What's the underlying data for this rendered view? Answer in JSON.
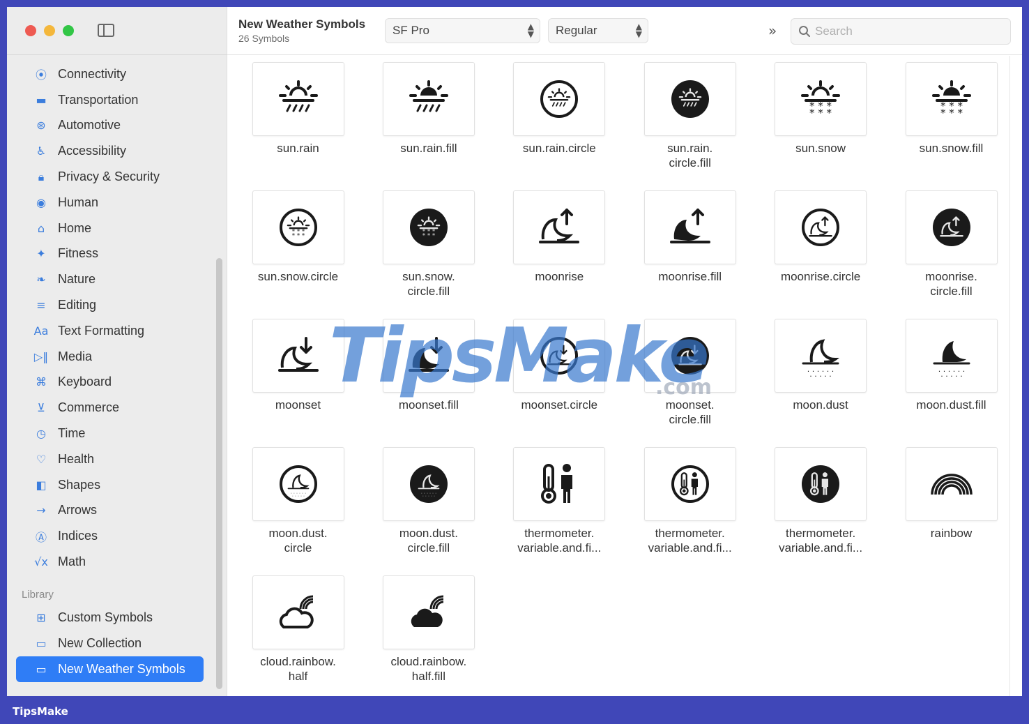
{
  "toolbar": {
    "collection_title": "New Weather Symbols",
    "symbol_count": "26 Symbols",
    "font_popup": "SF Pro",
    "weight_popup": "Regular",
    "search_placeholder": "Search"
  },
  "sidebar": {
    "categories": [
      {
        "label": "Connectivity",
        "icon": "antenna-icon"
      },
      {
        "label": "Transportation",
        "icon": "car-icon"
      },
      {
        "label": "Automotive",
        "icon": "steering-wheel-icon"
      },
      {
        "label": "Accessibility",
        "icon": "accessibility-icon"
      },
      {
        "label": "Privacy & Security",
        "icon": "lock-icon"
      },
      {
        "label": "Human",
        "icon": "person-circle-icon"
      },
      {
        "label": "Home",
        "icon": "house-icon"
      },
      {
        "label": "Fitness",
        "icon": "running-figure-icon"
      },
      {
        "label": "Nature",
        "icon": "leaf-icon"
      },
      {
        "label": "Editing",
        "icon": "sliders-icon"
      },
      {
        "label": "Text Formatting",
        "icon": "text-aa-icon"
      },
      {
        "label": "Media",
        "icon": "play-pause-icon"
      },
      {
        "label": "Keyboard",
        "icon": "command-key-icon"
      },
      {
        "label": "Commerce",
        "icon": "cart-icon"
      },
      {
        "label": "Time",
        "icon": "clock-icon"
      },
      {
        "label": "Health",
        "icon": "heart-icon"
      },
      {
        "label": "Shapes",
        "icon": "shapes-icon"
      },
      {
        "label": "Arrows",
        "icon": "arrow-right-icon"
      },
      {
        "label": "Indices",
        "icon": "circled-a-icon"
      },
      {
        "label": "Math",
        "icon": "square-root-icon"
      }
    ],
    "library_header": "Library",
    "library": [
      {
        "label": "Custom Symbols",
        "icon": "grid-icon"
      },
      {
        "label": "New Collection",
        "icon": "folder-icon"
      },
      {
        "label": "New Weather Symbols",
        "icon": "folder-icon",
        "selected": true
      }
    ],
    "accent_color": "#2f7df6"
  },
  "symbols": [
    {
      "name": "sun.rain",
      "icon": "sun-rain-icon"
    },
    {
      "name": "sun.rain.fill",
      "icon": "sun-rain-fill-icon"
    },
    {
      "name": "sun.rain.circle",
      "icon": "sun-rain-circle-icon"
    },
    {
      "name": "sun.rain.\ncircle.fill",
      "icon": "sun-rain-circle-fill-icon"
    },
    {
      "name": "sun.snow",
      "icon": "sun-snow-icon"
    },
    {
      "name": "sun.snow.fill",
      "icon": "sun-snow-fill-icon"
    },
    {
      "name": "sun.snow.circle",
      "icon": "sun-snow-circle-icon"
    },
    {
      "name": "sun.snow.\ncircle.fill",
      "icon": "sun-snow-circle-fill-icon"
    },
    {
      "name": "moonrise",
      "icon": "moonrise-icon"
    },
    {
      "name": "moonrise.fill",
      "icon": "moonrise-fill-icon"
    },
    {
      "name": "moonrise.circle",
      "icon": "moonrise-circle-icon"
    },
    {
      "name": "moonrise.\ncircle.fill",
      "icon": "moonrise-circle-fill-icon"
    },
    {
      "name": "moonset",
      "icon": "moonset-icon"
    },
    {
      "name": "moonset.fill",
      "icon": "moonset-fill-icon"
    },
    {
      "name": "moonset.circle",
      "icon": "moonset-circle-icon"
    },
    {
      "name": "moonset.\ncircle.fill",
      "icon": "moonset-circle-fill-icon"
    },
    {
      "name": "moon.dust",
      "icon": "moon-dust-icon"
    },
    {
      "name": "moon.dust.fill",
      "icon": "moon-dust-fill-icon"
    },
    {
      "name": "moon.dust.\ncircle",
      "icon": "moon-dust-circle-icon"
    },
    {
      "name": "moon.dust.\ncircle.fill",
      "icon": "moon-dust-circle-fill-icon"
    },
    {
      "name": "thermometer.\nvariable.and.fi...",
      "icon": "thermometer-person-icon"
    },
    {
      "name": "thermometer.\nvariable.and.fi...",
      "icon": "thermometer-person-circle-icon"
    },
    {
      "name": "thermometer.\nvariable.and.fi...",
      "icon": "thermometer-person-circle-fill-icon"
    },
    {
      "name": "rainbow",
      "icon": "rainbow-icon"
    },
    {
      "name": "cloud.rainbow.\nhalf",
      "icon": "cloud-rainbow-half-icon"
    },
    {
      "name": "cloud.rainbow.\nhalf.fill",
      "icon": "cloud-rainbow-half-fill-icon"
    }
  ],
  "watermark": {
    "brand": "TipsMake",
    "suffix": ".com"
  },
  "footer_brand": "TipsMake"
}
